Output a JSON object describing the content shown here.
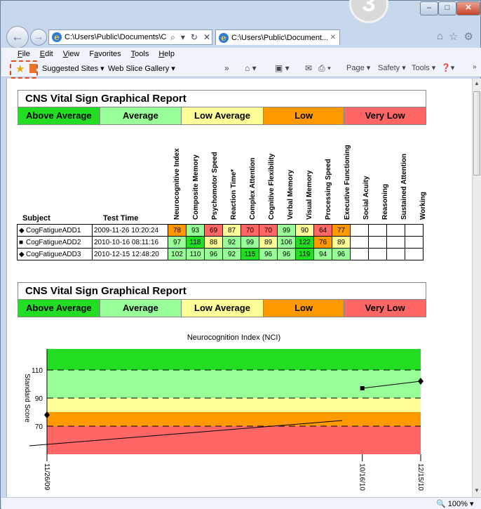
{
  "browser": {
    "step_badge": "3",
    "address": "C:\\Users\\Public\\Documents\\C",
    "tab_title": "C:\\Users\\Public\\Document...",
    "menu": [
      {
        "label": "File",
        "acc": "F",
        "rest": "ile"
      },
      {
        "label": "Edit",
        "acc": "E",
        "rest": "dit"
      },
      {
        "label": "View",
        "acc": "V",
        "rest": "iew"
      },
      {
        "label": "Favorites",
        "acc": "a",
        "rest": "Fvorites"
      },
      {
        "label": "Tools",
        "acc": "T",
        "rest": "ools"
      },
      {
        "label": "Help",
        "acc": "H",
        "rest": "elp"
      }
    ],
    "suggested_sites": "Suggested Sites ▾",
    "web_slice_gallery": "Web Slice Gallery ▾",
    "page_menu": "Page ▾",
    "safety_menu": "Safety ▾",
    "tools_menu": "Tools ▾",
    "zoom": "100%"
  },
  "report": {
    "title": "CNS Vital Sign Graphical Report",
    "legend": [
      "Above Average",
      "Average",
      "Low Average",
      "Low",
      "Very Low"
    ],
    "colors": {
      "above_average": "#22dd22",
      "average": "#99ff99",
      "low_average": "#ffff99",
      "low": "#ff9900",
      "very_low": "#ff6666"
    },
    "subject_header": "Subject",
    "test_time_header": "Test Time",
    "columns": [
      "Neurocognitive Index",
      "Composite Memory",
      "Psychomotor Speed",
      "Reaction Time*",
      "Complex Attention",
      "Cognitive Flexibility",
      "Verbal Memory",
      "Visual Memory",
      "Processing Speed",
      "Executive Functioning",
      "Social Acuity",
      "Reasoning",
      "Sustained Attention",
      "Working"
    ],
    "rows": [
      {
        "symbol": "◆",
        "subject": "CogFatigueADD1",
        "time": "2009-11-26 10:20:24",
        "scores": [
          "78",
          "93",
          "69",
          "87",
          "70",
          "70",
          "99",
          "90",
          "64",
          "77",
          "",
          "",
          "",
          ""
        ],
        "cats": [
          "low",
          "average",
          "very_low",
          "low_average",
          "very_low",
          "very_low",
          "average",
          "low_average",
          "very_low",
          "low",
          "",
          "",
          "",
          ""
        ]
      },
      {
        "symbol": "■",
        "subject": "CogFatigueADD2",
        "time": "2010-10-16 08:11:16",
        "scores": [
          "97",
          "118",
          "88",
          "92",
          "99",
          "89",
          "106",
          "122",
          "76",
          "89",
          "",
          "",
          "",
          ""
        ],
        "cats": [
          "average",
          "above_average",
          "low_average",
          "average",
          "average",
          "low_average",
          "average",
          "above_average",
          "low",
          "low_average",
          "",
          "",
          "",
          ""
        ]
      },
      {
        "symbol": "◆",
        "subject": "CogFatigueADD3",
        "time": "2010-12-15 12:48:20",
        "scores": [
          "102",
          "110",
          "96",
          "92",
          "115",
          "96",
          "96",
          "119",
          "94",
          "96",
          "",
          "",
          "",
          ""
        ],
        "cats": [
          "average",
          "average",
          "average",
          "average",
          "above_average",
          "average",
          "average",
          "above_average",
          "average",
          "average",
          "",
          "",
          "",
          ""
        ]
      }
    ]
  },
  "chart_data": {
    "type": "line",
    "title": "Neurocognition Index (NCI)",
    "ylabel": "Standard Score",
    "yticks": [
      70,
      90,
      110
    ],
    "ylim": [
      50,
      125
    ],
    "xticks": [
      "11/26/09",
      "10/16/10",
      "12/15/10"
    ],
    "series": [
      {
        "values": [
          {
            "x": "11/26/09",
            "y": 78
          },
          {
            "x": "10/16/10",
            "y": 97
          },
          {
            "x": "12/15/10",
            "y": 102
          }
        ]
      }
    ],
    "bands": [
      {
        "from": 50,
        "to": 70,
        "color": "#ff6666"
      },
      {
        "from": 70,
        "to": 80,
        "color": "#ff9900"
      },
      {
        "from": 80,
        "to": 90,
        "color": "#ffff99"
      },
      {
        "from": 90,
        "to": 110,
        "color": "#99ff99"
      },
      {
        "from": 110,
        "to": 125,
        "color": "#22dd22"
      }
    ]
  }
}
